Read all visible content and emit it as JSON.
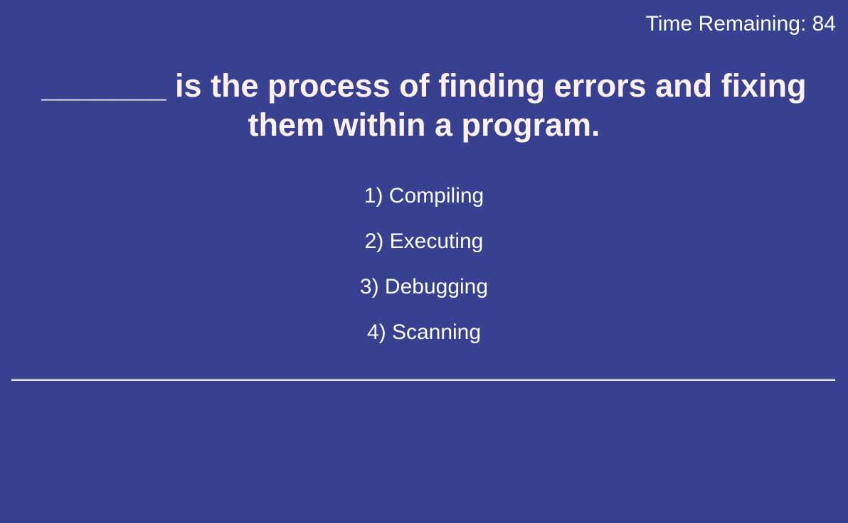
{
  "timer": {
    "text": "Time Remaining: 84"
  },
  "question": {
    "text": "_______ is the process of finding errors and fixing them within a program."
  },
  "options": [
    {
      "label": "1) Compiling"
    },
    {
      "label": "2) Executing"
    },
    {
      "label": "3) Debugging"
    },
    {
      "label": "4) Scanning"
    }
  ],
  "colors": {
    "background": "#37418f",
    "text": "#ffffff",
    "question_text": "#fdf0ee"
  }
}
